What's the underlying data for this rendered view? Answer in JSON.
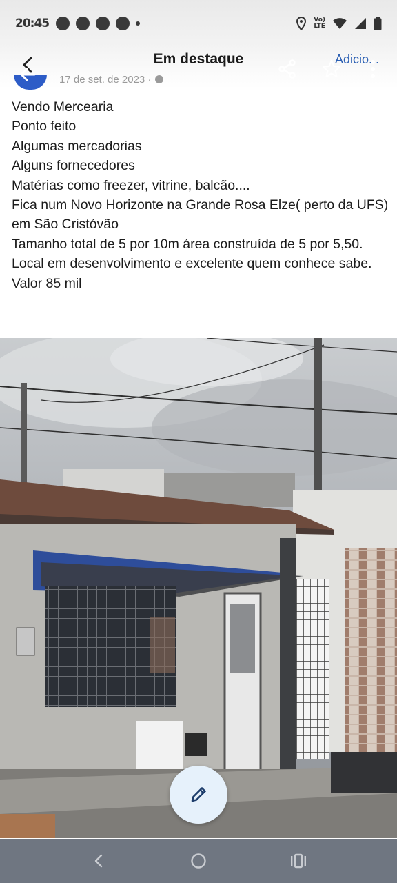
{
  "status_bar": {
    "time": "20:45",
    "network_label_top": "Vo)",
    "network_label_bottom": "LTE",
    "icons": [
      "notification-icon",
      "notification-icon",
      "notification-icon",
      "notification-icon",
      "location-icon",
      "volte-icon",
      "wifi-icon",
      "signal-icon",
      "battery-icon"
    ]
  },
  "header": {
    "title": "Em destaque",
    "add_link": "Adicio...",
    "underlying_date": "17 de set. de 2023 ·",
    "icons": [
      "back-arrow-icon",
      "share-icon",
      "star-icon",
      "more-vertical-icon"
    ]
  },
  "post": {
    "lines": [
      "Vendo Mercearia",
      "Ponto feito",
      "Algumas mercadorias",
      "Alguns fornecedores",
      "Matérias como freezer, vitrine, balcão....",
      "Fica num Novo Horizonte na Grande Rosa Elze( perto da UFS) em São Cristóvão",
      "Tamanho total de 5 por 10m área construída de 5 por 5,50.",
      "Local em desenvolvimento e excelente quem conhece sabe.",
      "Valor 85 mil"
    ]
  },
  "fab": {
    "icon": "pencil-icon"
  },
  "nav_bar": {
    "icons": [
      "back-icon",
      "home-icon",
      "recents-icon"
    ]
  },
  "colors": {
    "link": "#2b5fb3",
    "fab_bg": "#e6f1fb",
    "nav_bg": "#6f7681",
    "avatar": "#2d5cc7"
  }
}
